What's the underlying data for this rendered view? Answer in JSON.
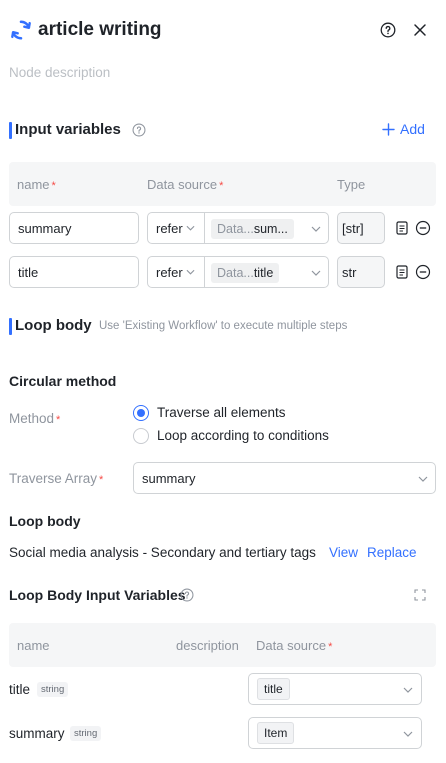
{
  "header": {
    "title": "article writing",
    "description_placeholder": "Node description"
  },
  "input_variables": {
    "title": "Input variables",
    "add_label": "Add",
    "columns": {
      "name": "name",
      "data_source": "Data source",
      "type": "Type"
    },
    "required_mark": "*",
    "rows": [
      {
        "name": "summary",
        "mode": "refer",
        "source_prefix": "Data...",
        "source_value": "sum...",
        "type": "[str]"
      },
      {
        "name": "title",
        "mode": "refer",
        "source_prefix": "Data...",
        "source_value": "title",
        "type": "str"
      }
    ]
  },
  "loop_body": {
    "title": "Loop body",
    "hint": "Use 'Existing Workflow' to execute multiple steps",
    "circular_method": {
      "title": "Circular method",
      "method_label": "Method",
      "options": [
        {
          "label": "Traverse all elements",
          "selected": true
        },
        {
          "label": "Loop according to conditions",
          "selected": false
        }
      ]
    },
    "traverse_array": {
      "label": "Traverse Array",
      "value": "summary"
    },
    "workflow": {
      "section_title": "Loop body",
      "name": "Social media analysis - Secondary and tertiary tags",
      "view_label": "View",
      "replace_label": "Replace"
    },
    "input_variables": {
      "title": "Loop Body Input Variables",
      "columns": {
        "name": "name",
        "description": "description",
        "data_source": "Data source"
      },
      "rows": [
        {
          "name": "title",
          "type": "string",
          "source": "title"
        },
        {
          "name": "summary",
          "type": "string",
          "source": "Item"
        }
      ]
    }
  },
  "colors": {
    "accent": "#3370ff",
    "required": "#f54a45",
    "muted": "#8f959e"
  },
  "icons": [
    "refresh-icon",
    "help-icon",
    "close-icon",
    "plus-icon",
    "chevron-down-icon",
    "document-icon",
    "remove-icon",
    "expand-icon"
  ]
}
